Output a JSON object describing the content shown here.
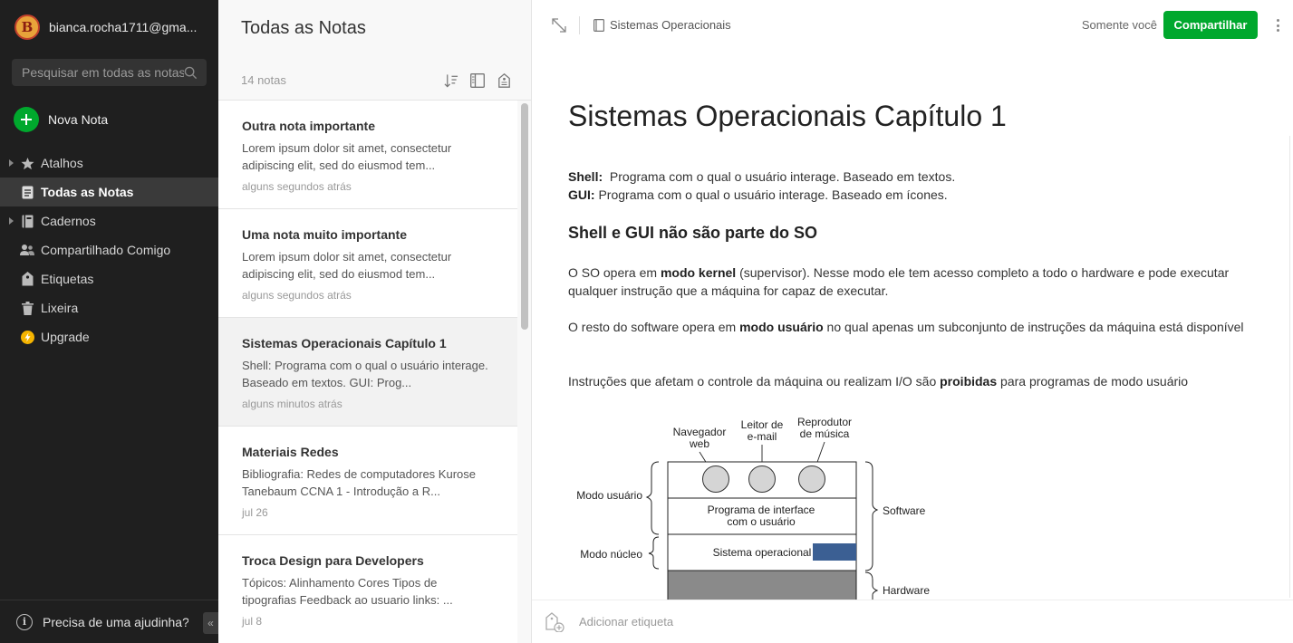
{
  "sidebar": {
    "avatar_letter": "B",
    "account": "bianca.rocha1711@gma...",
    "search_placeholder": "Pesquisar em todas as notas",
    "new_note": "Nova Nota",
    "items": [
      {
        "label": "Atalhos",
        "icon": "star-icon",
        "expandable": true
      },
      {
        "label": "Todas as Notas",
        "icon": "notes-icon",
        "active": true
      },
      {
        "label": "Cadernos",
        "icon": "notebook-icon",
        "expandable": true
      },
      {
        "label": "Compartilhado Comigo",
        "icon": "people-icon"
      },
      {
        "label": "Etiquetas",
        "icon": "tag-icon"
      },
      {
        "label": "Lixeira",
        "icon": "trash-icon"
      },
      {
        "label": "Upgrade",
        "icon": "upgrade-icon"
      }
    ],
    "help": "Precisa de uma ajudinha?"
  },
  "notelist": {
    "title": "Todas as Notas",
    "count": "14 notas",
    "notes": [
      {
        "title": "Outra nota importante",
        "snippet": "Lorem ipsum dolor sit amet, consectetur adipiscing elit, sed do eiusmod tem...",
        "time": "alguns segundos atrás"
      },
      {
        "title": "Uma nota muito importante",
        "snippet": "Lorem ipsum dolor sit amet, consectetur adipiscing elit, sed do eiusmod tem...",
        "time": "alguns segundos atrás"
      },
      {
        "title": "Sistemas Operacionais Capítulo 1",
        "snippet": "Shell: Programa com o qual o usuário interage. Baseado em textos. GUI: Prog...",
        "time": "alguns minutos atrás",
        "selected": true
      },
      {
        "title": "Materiais Redes",
        "snippet": "Bibliografia: Redes de computadores Kurose Tanebaum CCNA 1 - Introdução a R...",
        "time": "jul 26"
      },
      {
        "title": "Troca Design para Developers",
        "snippet": "Tópicos: Alinhamento Cores Tipos de tipografias Feedback ao usuario links: ...",
        "time": "jul 8"
      }
    ]
  },
  "editor": {
    "notebook": "Sistemas Operacionais",
    "share_scope": "Somente você",
    "share_button": "Compartilhar",
    "title": "Sistemas Operacionais Capítulo 1",
    "p1_label": "Shell:",
    "p1_text": "Programa com o qual o usuário interage. Baseado em textos.",
    "p2_label": "GUI:",
    "p2_text": "Programa com o qual o usuário interage. Baseado em ícones.",
    "heading": "Shell e GUI não são parte do SO",
    "p3_a": "O SO opera em ",
    "p3_b": "modo kernel",
    "p3_c": " (supervisor). Nesse modo ele tem acesso completo a todo o hardware e pode executar qualquer instrução que a máquina for capaz de executar.",
    "p4_a": "O resto do software opera em ",
    "p4_b": "modo usuário",
    "p4_c": "  no qual apenas um subconjunto de instruções da máquina está disponível",
    "p5_a": "Instruções que afetam o controle da máquina ou realizam I/O são ",
    "p5_b": "proibidas",
    "p5_c": "  para programas de modo usuário",
    "diagram": {
      "app1_l1": "Navegador",
      "app1_l2": "web",
      "app2_l1": "Leitor de",
      "app2_l2": "e-mail",
      "app3_l1": "Reprodutor",
      "app3_l2": "de música",
      "mode_user": "Modo usuário",
      "mode_kernel": "Modo núcleo",
      "interface_l1": "Programa de interface",
      "interface_l2": "com o usuário",
      "os": "Sistema operacional",
      "software": "Software",
      "hardware": "Hardware"
    },
    "tag_placeholder": "Adicionar etiqueta"
  }
}
